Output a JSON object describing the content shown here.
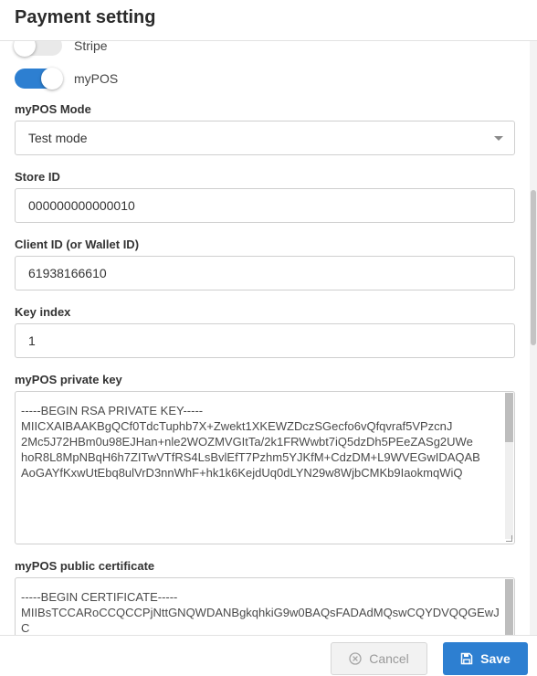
{
  "header": {
    "title": "Payment setting"
  },
  "toggles": [
    {
      "label": "Stripe",
      "state": "off"
    },
    {
      "label": "myPOS",
      "state": "on"
    }
  ],
  "mypos_mode": {
    "label": "myPOS Mode",
    "value": "Test mode"
  },
  "store_id": {
    "label": "Store ID",
    "value": "000000000000010"
  },
  "client_id": {
    "label": "Client ID (or Wallet ID)",
    "value": "61938166610"
  },
  "key_index": {
    "label": "Key index",
    "value": "1"
  },
  "private_key": {
    "label": "myPOS private key",
    "value": "-----BEGIN RSA PRIVATE KEY-----\nMIICXAIBAAKBgQCf0TdcTuphb7X+Zwekt1XKEWZDczSGecfo6vQfqvraf5VPzcnJ\n2Mc5J72HBm0u98EJHan+nle2WOZMVGItTa/2k1FRWwbt7iQ5dzDh5PEeZASg2UWe\nhoR8L8MpNBqH6h7ZITwVTfRS4LsBvlEfT7Pzhm5YJKfM+CdzDM+L9WVEGwIDAQAB\nAoGAYfKxwUtEbq8ulVrD3nnWhF+hk1k6KejdUq0dLYN29w8WjbCMKb9IaokmqWiQ"
  },
  "public_cert": {
    "label": "myPOS public certificate",
    "value": "-----BEGIN CERTIFICATE-----\nMIIBsTCCARoCCQCCPjNttGNQWDANBgkqhkiG9w0BAQsFADAdMQswCQYDVQQGEwJC"
  },
  "footer": {
    "cancel_label": "Cancel",
    "save_label": "Save"
  },
  "colors": {
    "accent": "#2d7fd1"
  }
}
